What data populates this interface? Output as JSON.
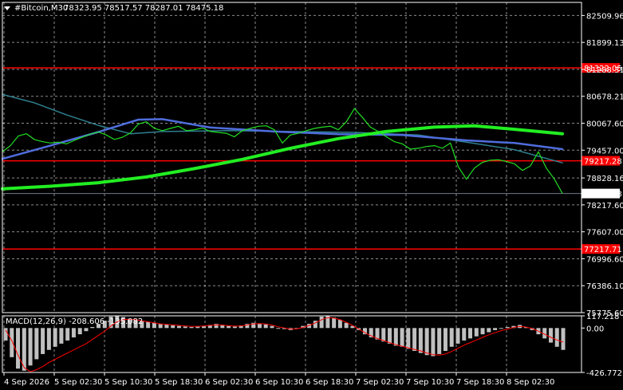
{
  "header": {
    "symbol": "#Bitcoin,M30",
    "ohlc": "78323.95 78517.57 78287.01 78475.18"
  },
  "chart_data": {
    "type": "line",
    "main": {
      "ylim": [
        75775.6,
        82806
      ],
      "y_ticks": [
        "82509.96",
        "81899.13",
        "81288.31",
        "80678.21",
        "80067.60",
        "79457.00",
        "78828.16",
        "78217.60",
        "77607.00",
        "76996.60",
        "76386.10",
        "75775.60"
      ],
      "last_price": "78475.18",
      "levels": [
        {
          "label": "81322.05",
          "value": 81322.05,
          "color": "#ff0000"
        },
        {
          "label": "79217.28",
          "value": 79217.28,
          "color": "#ff0000"
        },
        {
          "label": "77217.71",
          "value": 77217.71,
          "color": "#ff0000"
        }
      ],
      "price_series": [
        {
          "x": 0,
          "y": 79420
        },
        {
          "x": 0.5,
          "y": 79560
        },
        {
          "x": 1,
          "y": 79780
        },
        {
          "x": 1.5,
          "y": 79830
        },
        {
          "x": 2,
          "y": 79700
        },
        {
          "x": 2.5,
          "y": 79650
        },
        {
          "x": 3,
          "y": 79620
        },
        {
          "x": 3.5,
          "y": 79640
        },
        {
          "x": 4,
          "y": 79600
        },
        {
          "x": 4.5,
          "y": 79680
        },
        {
          "x": 5,
          "y": 79750
        },
        {
          "x": 5.5,
          "y": 79820
        },
        {
          "x": 6,
          "y": 79870
        },
        {
          "x": 6.5,
          "y": 79800
        },
        {
          "x": 7,
          "y": 79700
        },
        {
          "x": 7.5,
          "y": 79750
        },
        {
          "x": 8,
          "y": 79850
        },
        {
          "x": 8.5,
          "y": 80050
        },
        {
          "x": 9,
          "y": 80100
        },
        {
          "x": 9.5,
          "y": 79950
        },
        {
          "x": 10,
          "y": 79900
        },
        {
          "x": 10.5,
          "y": 79950
        },
        {
          "x": 11,
          "y": 80000
        },
        {
          "x": 11.5,
          "y": 79900
        },
        {
          "x": 12,
          "y": 79920
        },
        {
          "x": 12.5,
          "y": 79960
        },
        {
          "x": 13,
          "y": 79880
        },
        {
          "x": 13.5,
          "y": 79860
        },
        {
          "x": 14,
          "y": 79840
        },
        {
          "x": 14.5,
          "y": 79760
        },
        {
          "x": 15,
          "y": 79900
        },
        {
          "x": 15.5,
          "y": 79950
        },
        {
          "x": 16,
          "y": 80000
        },
        {
          "x": 16.5,
          "y": 80010
        },
        {
          "x": 17,
          "y": 79920
        },
        {
          "x": 17.5,
          "y": 79620
        },
        {
          "x": 18,
          "y": 79800
        },
        {
          "x": 18.5,
          "y": 79840
        },
        {
          "x": 19,
          "y": 79900
        },
        {
          "x": 19.5,
          "y": 79950
        },
        {
          "x": 20,
          "y": 79980
        },
        {
          "x": 20.5,
          "y": 80000
        },
        {
          "x": 21,
          "y": 79920
        },
        {
          "x": 21.5,
          "y": 80100
        },
        {
          "x": 22,
          "y": 80400
        },
        {
          "x": 22.5,
          "y": 80200
        },
        {
          "x": 23,
          "y": 79980
        },
        {
          "x": 23.5,
          "y": 79880
        },
        {
          "x": 24,
          "y": 79760
        },
        {
          "x": 24.5,
          "y": 79650
        },
        {
          "x": 25,
          "y": 79600
        },
        {
          "x": 25.5,
          "y": 79480
        },
        {
          "x": 26,
          "y": 79500
        },
        {
          "x": 26.5,
          "y": 79540
        },
        {
          "x": 27,
          "y": 79560
        },
        {
          "x": 27.5,
          "y": 79500
        },
        {
          "x": 28,
          "y": 79620
        },
        {
          "x": 28.5,
          "y": 79080
        },
        {
          "x": 29,
          "y": 78800
        },
        {
          "x": 29.5,
          "y": 79050
        },
        {
          "x": 30,
          "y": 79180
        },
        {
          "x": 30.5,
          "y": 79230
        },
        {
          "x": 31,
          "y": 79240
        },
        {
          "x": 31.5,
          "y": 79200
        },
        {
          "x": 32,
          "y": 79150
        },
        {
          "x": 32.5,
          "y": 79000
        },
        {
          "x": 33,
          "y": 79100
        },
        {
          "x": 33.5,
          "y": 79420
        },
        {
          "x": 34,
          "y": 79050
        },
        {
          "x": 34.5,
          "y": 78800
        },
        {
          "x": 35,
          "y": 78480
        }
      ],
      "ma_fast": {
        "color": "#4f6ddc",
        "points": [
          {
            "x": 0,
            "y": 79260
          },
          {
            "x": 3,
            "y": 79560
          },
          {
            "x": 6,
            "y": 79870
          },
          {
            "x": 8.5,
            "y": 80150
          },
          {
            "x": 10,
            "y": 80160
          },
          {
            "x": 13,
            "y": 79970
          },
          {
            "x": 17,
            "y": 79880
          },
          {
            "x": 21,
            "y": 79820
          },
          {
            "x": 25,
            "y": 79800
          },
          {
            "x": 29,
            "y": 79680
          },
          {
            "x": 32,
            "y": 79620
          },
          {
            "x": 35,
            "y": 79480
          }
        ]
      },
      "ma_slow": {
        "color": "#2f7f8f",
        "points": [
          {
            "x": 0,
            "y": 80720
          },
          {
            "x": 2,
            "y": 80530
          },
          {
            "x": 4,
            "y": 80260
          },
          {
            "x": 6,
            "y": 80020
          },
          {
            "x": 8,
            "y": 79830
          },
          {
            "x": 10,
            "y": 79880
          },
          {
            "x": 14,
            "y": 79900
          },
          {
            "x": 18,
            "y": 79880
          },
          {
            "x": 22,
            "y": 79860
          },
          {
            "x": 26,
            "y": 79800
          },
          {
            "x": 29,
            "y": 79640
          },
          {
            "x": 32,
            "y": 79470
          },
          {
            "x": 35,
            "y": 79170
          }
        ]
      },
      "ma_trend": {
        "color": "#22ee22",
        "points": [
          {
            "x": 0,
            "y": 78580
          },
          {
            "x": 3,
            "y": 78640
          },
          {
            "x": 6,
            "y": 78720
          },
          {
            "x": 9,
            "y": 78850
          },
          {
            "x": 12,
            "y": 79040
          },
          {
            "x": 15,
            "y": 79250
          },
          {
            "x": 18,
            "y": 79500
          },
          {
            "x": 21,
            "y": 79720
          },
          {
            "x": 24,
            "y": 79880
          },
          {
            "x": 27,
            "y": 79980
          },
          {
            "x": 29.5,
            "y": 80010
          },
          {
            "x": 32,
            "y": 79930
          },
          {
            "x": 35,
            "y": 79830
          }
        ]
      }
    },
    "macd": {
      "label": "MACD(12,26,9) -208.606 -135.082",
      "ylim": [
        -426.772,
        117.218
      ],
      "y_ticks": [
        "117.218",
        "0.00",
        "-426.772"
      ],
      "histogram": [
        -120,
        -280,
        -390,
        -410,
        -360,
        -300,
        -250,
        -210,
        -180,
        -150,
        -120,
        -90,
        -60,
        -30,
        10,
        40,
        70,
        110,
        115,
        105,
        90,
        80,
        70,
        60,
        50,
        40,
        35,
        25,
        20,
        15,
        10,
        15,
        20,
        30,
        40,
        30,
        20,
        15,
        25,
        40,
        50,
        45,
        35,
        20,
        0,
        -10,
        -20,
        -5,
        20,
        40,
        70,
        110,
        117,
        100,
        80,
        50,
        20,
        -20,
        -60,
        -90,
        -110,
        -130,
        -150,
        -170,
        -180,
        -200,
        -220,
        -240,
        -260,
        -270,
        -250,
        -220,
        -180,
        -150,
        -120,
        -100,
        -80,
        -60,
        -40,
        -20,
        0,
        10,
        20,
        30,
        10,
        -20,
        -60,
        -100,
        -140,
        -180,
        -210
      ],
      "signal": [
        -20,
        -120,
        -260,
        -380,
        -420,
        -400,
        -370,
        -330,
        -300,
        -270,
        -240,
        -210,
        -180,
        -150,
        -110,
        -70,
        -30,
        20,
        60,
        80,
        85,
        80,
        70,
        60,
        50,
        40,
        35,
        30,
        25,
        20,
        15,
        15,
        20,
        25,
        30,
        28,
        22,
        18,
        20,
        30,
        40,
        42,
        38,
        28,
        12,
        0,
        -10,
        -8,
        5,
        25,
        50,
        80,
        100,
        95,
        80,
        55,
        25,
        -10,
        -45,
        -75,
        -100,
        -120,
        -140,
        -160,
        -175,
        -190,
        -205,
        -220,
        -240,
        -255,
        -260,
        -250,
        -225,
        -195,
        -165,
        -140,
        -115,
        -90,
        -65,
        -45,
        -25,
        -10,
        5,
        15,
        10,
        -5,
        -30,
        -60,
        -90,
        -115,
        -135
      ]
    },
    "x_labels": [
      "4 Sep 2026",
      "5 Sep 02:30",
      "5 Sep 10:30",
      "5 Sep 18:30",
      "6 Sep 02:30",
      "6 Sep 10:30",
      "6 Sep 18:30",
      "7 Sep 02:30",
      "7 Sep 10:30",
      "7 Sep 18:30",
      "8 Sep 02:30"
    ]
  }
}
